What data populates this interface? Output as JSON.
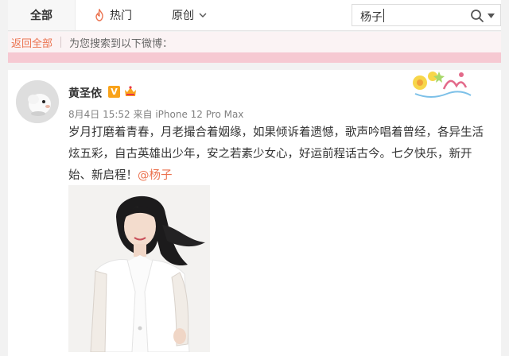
{
  "nav": {
    "tab_all": "全部",
    "tab_hot": "热门",
    "tab_original": "原创"
  },
  "search": {
    "value": "杨子"
  },
  "results_bar": {
    "back_label": "返回全部",
    "result_text": "为您搜索到以下微博："
  },
  "post": {
    "username": "黄圣依",
    "verified_badge": "V",
    "date": "8月4日 15:52",
    "source_prefix": "来自",
    "device": "iPhone 12 Pro Max",
    "body": "岁月打磨着青春，月老撮合着姻缘，如果倾诉着遗憾，歌声吟唱着曾经，各异生活炫五彩，自古英雄出少年，安之若素少女心，好运前程话古今。七夕快乐，新开始、新启程！",
    "mention": "@杨子"
  },
  "colors": {
    "accent": "#eb7350",
    "pink_band": "#f6c9d2",
    "badge_orange": "#f9a31a"
  }
}
